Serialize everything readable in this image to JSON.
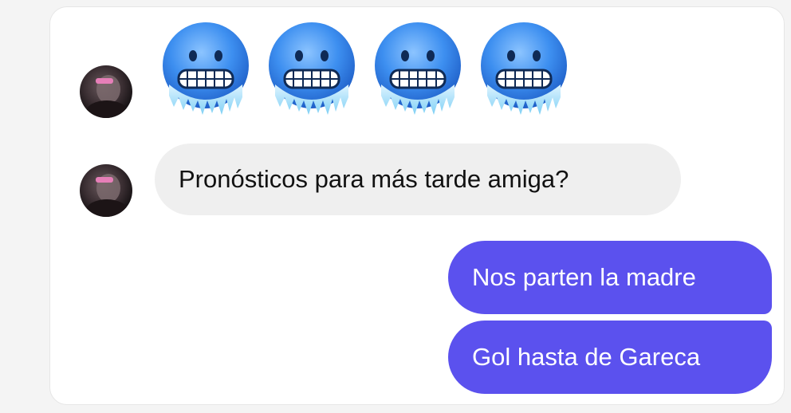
{
  "conversation": {
    "incoming": {
      "emojis": [
        "cold-face",
        "cold-face",
        "cold-face",
        "cold-face"
      ],
      "message": "Pronósticos para más tarde amiga?"
    },
    "outgoing": [
      "Nos parten la madre",
      "Gol hasta de Gareca"
    ]
  },
  "colors": {
    "outgoing_bubble": "#5b51ee",
    "incoming_bubble": "#efefef",
    "emoji_face": "#3d8ff0"
  }
}
